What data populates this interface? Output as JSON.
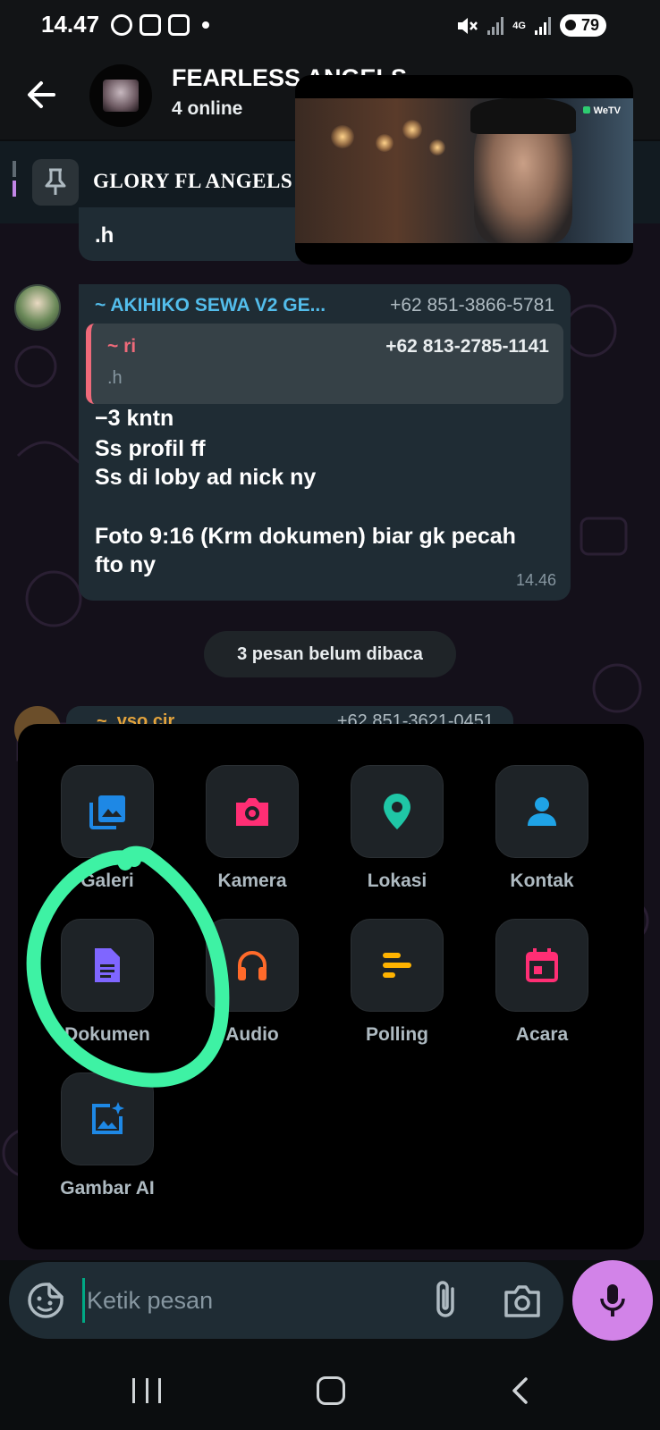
{
  "status_bar": {
    "time": "14.47",
    "network": "4G",
    "battery": "79"
  },
  "header": {
    "group_name": "FEARLESS ANGELS",
    "status": "4 online"
  },
  "pinned": {
    "text": "GLORY FL ANGELS"
  },
  "pip": {
    "brand": "WeTV"
  },
  "messages": {
    "prev_fragment": ".h",
    "main": {
      "sender": "~ AKIHIKO SEWA V2 GE...",
      "phone": "+62 851-3866-5781",
      "quote_sender": "~ ri",
      "quote_phone": "+62 813-2785-1141",
      "quote_text": ".h",
      "line1": "−3 kntn",
      "line2": "Ss profil ff",
      "line3": "Ss di loby ad nick ny",
      "line4": "Foto 9:16 (Krm dokumen) biar gk pecah",
      "line5": "fto ny",
      "time": "14.46"
    },
    "unread_divider": "3 pesan belum dibaca",
    "next_partial": {
      "sender": "~ .vso.cir",
      "phone": "+62 851-3621-0451"
    }
  },
  "attach_menu": {
    "items": [
      {
        "label": "Galeri",
        "icon": "gallery-icon",
        "color": "#1e88e5"
      },
      {
        "label": "Kamera",
        "icon": "camera-icon",
        "color": "#ff2e74"
      },
      {
        "label": "Lokasi",
        "icon": "location-icon",
        "color": "#1fc6a6"
      },
      {
        "label": "Kontak",
        "icon": "contact-icon",
        "color": "#1fa3e6"
      },
      {
        "label": "Dokumen",
        "icon": "document-icon",
        "color": "#7f66ff"
      },
      {
        "label": "Audio",
        "icon": "headphones-icon",
        "color": "#ff6a2a"
      },
      {
        "label": "Polling",
        "icon": "poll-icon",
        "color": "#ffb300"
      },
      {
        "label": "Acara",
        "icon": "calendar-icon",
        "color": "#ff2e74"
      },
      {
        "label": "Gambar AI",
        "icon": "ai-image-icon",
        "color": "#1e88e5"
      }
    ]
  },
  "composer": {
    "placeholder": "Ketik pesan"
  },
  "annotation_color": "#3ef2a4"
}
